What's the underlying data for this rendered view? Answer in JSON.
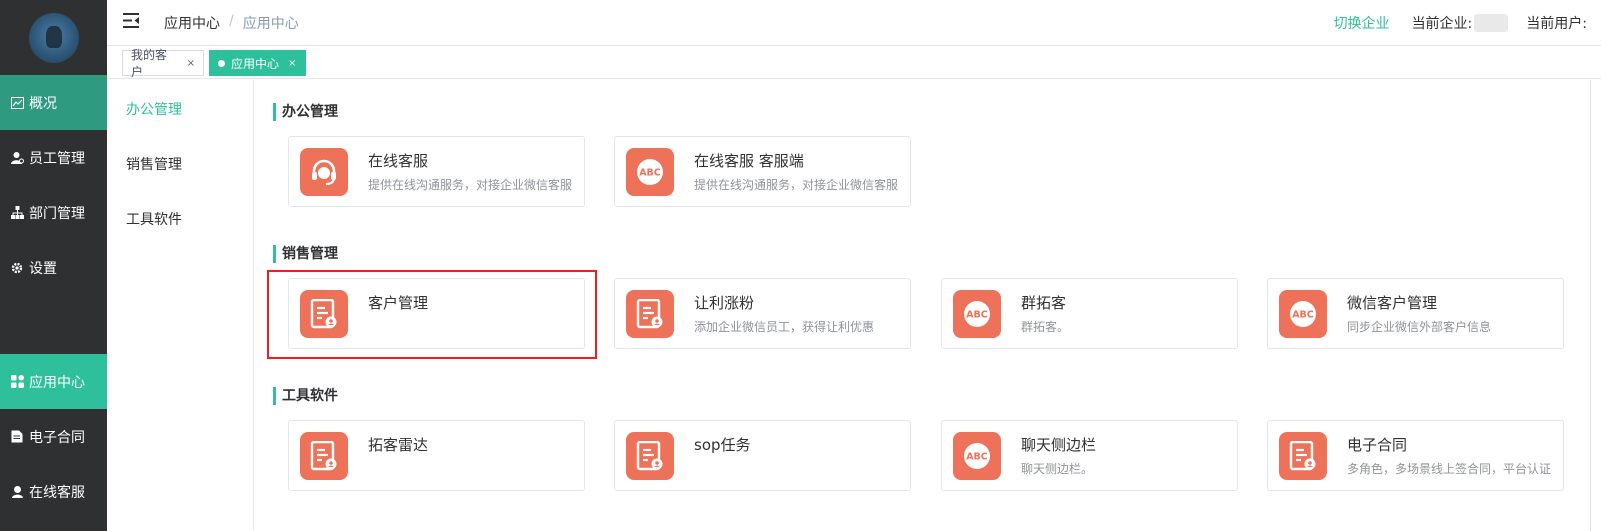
{
  "sidebar": {
    "items": [
      {
        "label": "概况",
        "icon": "chart-icon"
      },
      {
        "label": "员工管理",
        "icon": "user-icon"
      },
      {
        "label": "部门管理",
        "icon": "org-icon"
      },
      {
        "label": "设置",
        "icon": "gear-icon"
      },
      {
        "label": "应用中心",
        "icon": "apps-icon"
      },
      {
        "label": "电子合同",
        "icon": "document-icon"
      },
      {
        "label": "在线客服",
        "icon": "support-icon"
      }
    ]
  },
  "header": {
    "breadcrumb": [
      "应用中心",
      "应用中心"
    ],
    "switch_enterprise": "切换企业",
    "current_enterprise_label": "当前企业:",
    "current_user_label": "当前用户:"
  },
  "tabs": [
    {
      "label": "我的客户",
      "close": "×"
    },
    {
      "label": "应用中心",
      "close": "×"
    }
  ],
  "subnav": [
    "办公管理",
    "销售管理",
    "工具软件"
  ],
  "sections": [
    {
      "title": "办公管理",
      "cards": [
        {
          "name": "在线客服",
          "desc": "提供在线沟通服务，对接企业微信客服",
          "icon": "headset-icon"
        },
        {
          "name": "在线客服 客服端",
          "desc": "提供在线沟通服务，对接企业微信客服",
          "icon": "abc-icon"
        }
      ]
    },
    {
      "title": "销售管理",
      "cards": [
        {
          "name": "客户管理",
          "desc": "",
          "icon": "form-icon"
        },
        {
          "name": "让利涨粉",
          "desc": "添加企业微信员工，获得让利优惠",
          "icon": "form-icon"
        },
        {
          "name": "群拓客",
          "desc": "群拓客。",
          "icon": "abc-icon"
        },
        {
          "name": "微信客户管理",
          "desc": "同步企业微信外部客户信息",
          "icon": "abc-icon"
        }
      ]
    },
    {
      "title": "工具软件",
      "cards": [
        {
          "name": "拓客雷达",
          "desc": "",
          "icon": "form-icon"
        },
        {
          "name": "sop任务",
          "desc": "",
          "icon": "form-icon"
        },
        {
          "name": "聊天侧边栏",
          "desc": "聊天侧边栏。",
          "icon": "abc-icon"
        },
        {
          "name": "电子合同",
          "desc": "多角色，多场景线上签合同，平台认证",
          "icon": "form-icon"
        }
      ]
    }
  ],
  "colors": {
    "accent": "#2ec09a",
    "icon_bg": "#ee7259",
    "sidebar_bg": "#2f3031",
    "highlight": "#f01e1e"
  }
}
